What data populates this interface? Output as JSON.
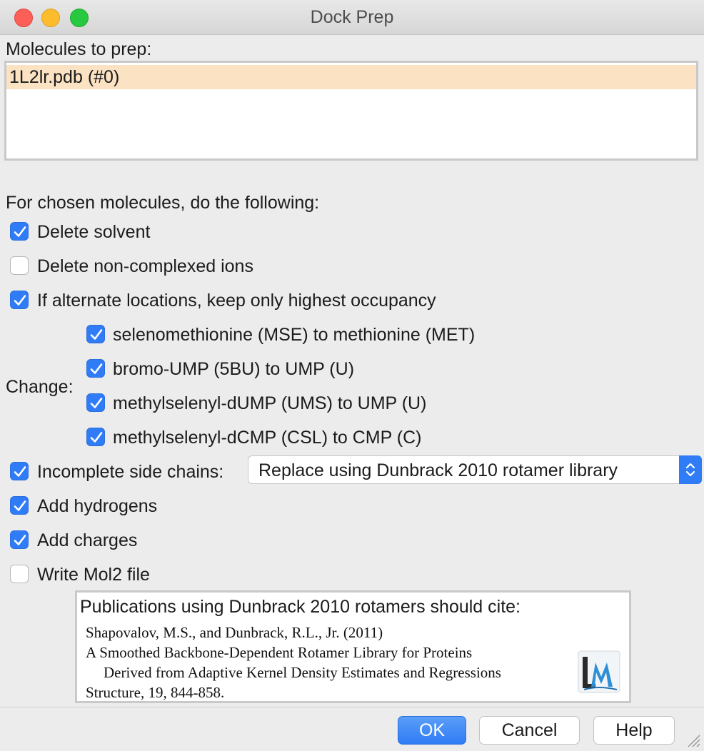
{
  "window": {
    "title": "Dock Prep"
  },
  "molecules": {
    "label": "Molecules to prep:",
    "items": [
      "1L2lr.pdb (#0)"
    ]
  },
  "options": {
    "heading": "For chosen molecules, do the following:",
    "delete_solvent": {
      "label": "Delete solvent",
      "checked": true
    },
    "delete_ions": {
      "label": "Delete non-complexed ions",
      "checked": false
    },
    "alt_locations": {
      "label": "If alternate locations, keep only highest occupancy",
      "checked": true
    },
    "change_label": "Change:",
    "change_items": [
      {
        "label": "selenomethionine (MSE) to methionine (MET)",
        "checked": true
      },
      {
        "label": "bromo-UMP (5BU) to UMP (U)",
        "checked": true
      },
      {
        "label": "methylselenyl-dUMP (UMS) to UMP (U)",
        "checked": true
      },
      {
        "label": "methylselenyl-dCMP (CSL) to CMP (C)",
        "checked": true
      }
    ],
    "side_chains": {
      "label": "Incomplete side chains:",
      "checked": true,
      "selected": "Replace using Dunbrack 2010 rotamer library"
    },
    "add_hydrogens": {
      "label": "Add hydrogens",
      "checked": true
    },
    "add_charges": {
      "label": "Add charges",
      "checked": true
    },
    "write_mol2": {
      "label": "Write Mol2 file",
      "checked": false
    }
  },
  "citation": {
    "heading": "Publications using Dunbrack 2010 rotamers should cite:",
    "authors": "Shapovalov, M.S., and Dunbrack, R.L., Jr. (2011)",
    "title_line1": "A Smoothed Backbone-Dependent Rotamer Library for Proteins",
    "title_line2": "Derived from Adaptive Kernel Density Estimates and Regressions",
    "journal": "Structure, 19, 844-858."
  },
  "buttons": {
    "ok": "OK",
    "cancel": "Cancel",
    "help": "Help"
  },
  "colors": {
    "accent": "#2f7cf6",
    "selection": "#fbe2c3"
  }
}
